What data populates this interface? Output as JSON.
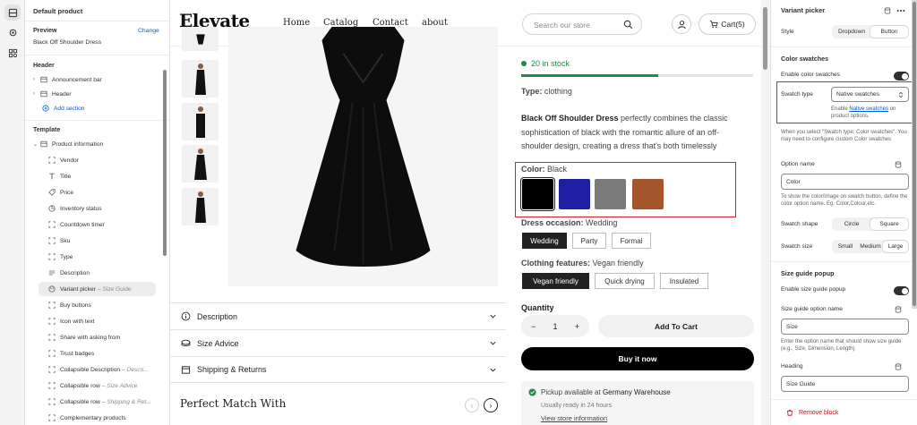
{
  "sidebar": {
    "title": "Default product",
    "preview_label": "Preview",
    "change_link": "Change",
    "preview_value": "Black Off Shoulder Dress",
    "header_section": "Header",
    "header_items": [
      "Announcement bar",
      "Header"
    ],
    "add_section": "Add section",
    "template_section": "Template",
    "product_info": "Product information",
    "blocks": [
      {
        "label": "Vendor",
        "sub": ""
      },
      {
        "label": "Title",
        "sub": ""
      },
      {
        "label": "Price",
        "sub": ""
      },
      {
        "label": "Inventory status",
        "sub": ""
      },
      {
        "label": "Countdown timer",
        "sub": ""
      },
      {
        "label": "Sku",
        "sub": ""
      },
      {
        "label": "Type",
        "sub": ""
      },
      {
        "label": "Description",
        "sub": ""
      },
      {
        "label": "Variant picker",
        "sub": "– Size Guide"
      },
      {
        "label": "Buy buttons",
        "sub": ""
      },
      {
        "label": "Icon with text",
        "sub": ""
      },
      {
        "label": "Share with asking from",
        "sub": ""
      },
      {
        "label": "Trust badges",
        "sub": ""
      },
      {
        "label": "Collapsible Description",
        "sub": "– Descri..."
      },
      {
        "label": "Collapsible row",
        "sub": "– Size Advice"
      },
      {
        "label": "Collapsible row",
        "sub": "– Shipping & Ret..."
      },
      {
        "label": "Complementary products",
        "sub": ""
      }
    ]
  },
  "store": {
    "logo": "Elevate",
    "nav": [
      "Home",
      "Catalog",
      "Contact",
      "about"
    ],
    "search_placeholder": "Search our store",
    "cart_label": "Cart(5)"
  },
  "product": {
    "stock": "20 in stock",
    "stock_level": 0.59,
    "type_label": "Type:",
    "type_value": "clothing",
    "desc_bold": "Black Off Shoulder Dress",
    "desc_rest": " perfectly combines the classic sophistication of black with the romantic allure of an off-shoulder design, creating a dress that's both timelessly",
    "color_label": "Color:",
    "color_value": "Black",
    "swatches": [
      "#000000",
      "#1f1fa3",
      "#7a7a7a",
      "#a4552b"
    ],
    "occasion_label": "Dress occasion:",
    "occasion_value": "Wedding",
    "occasions": [
      "Wedding",
      "Party",
      "Formal"
    ],
    "features_label": "Clothing features:",
    "features_value": "Vegan friendly",
    "features": [
      "Vegan friendly",
      "Quick drying",
      "Insulated"
    ],
    "quantity_label": "Quantity",
    "qty_minus": "−",
    "qty_value": "1",
    "qty_plus": "+",
    "add_to_cart": "Add To Cart",
    "buy_now": "Buy it now",
    "pickup_prefix": "Pickup available at ",
    "pickup_location": "Germany Warehouse",
    "pickup_ready": "Usually ready in 24 hours",
    "pickup_link": "View store information",
    "accordions": [
      "Description",
      "Size Advice",
      "Shipping & Returns"
    ],
    "related_title": "Perfect Match With",
    "prev_arrow": "‹",
    "next_arrow": "›"
  },
  "panel": {
    "title": "Variant picker",
    "style_label": "Style",
    "style_options": [
      "Dropdown",
      "Button"
    ],
    "color_swatches": "Color swatches",
    "enable_swatches": "Enable color swatches",
    "swatch_type_label": "Swatch type",
    "swatch_type_value": "Native swatches",
    "native_help_pre": "Enable ",
    "native_help_link": "Native swatches",
    "native_help_post": " on product options.",
    "swatch_note": "When you select \"Swatch type: Color swatches\". You may need to configure custom Color swatches",
    "option_name_label": "Option name",
    "option_name_value": "Color",
    "option_name_help": "To show the color/image on swatch button, define the color option name. Eg. Color,Colour,etc.",
    "swatch_shape_label": "Swatch shape",
    "swatch_shapes": [
      "Circle",
      "Square"
    ],
    "swatch_size_label": "Swatch size",
    "swatch_sizes": [
      "Small",
      "Medium",
      "Large"
    ],
    "size_guide_popup": "Size guide popup",
    "enable_size_guide": "Enable size guide popup",
    "size_guide_option_label": "Size guide option name",
    "size_guide_option_value": "Size",
    "size_guide_help": "Enter the option name that should show size guide (e.g., Size, Dimension, Length)",
    "heading_label": "Heading",
    "heading_value": "Size Guide",
    "remove_block": "Remove block"
  },
  "colors": {
    "accent_link": "#005bd3",
    "highlight": "#d9202b",
    "stock_green": "#1f8a4c",
    "danger": "#c70a24"
  }
}
